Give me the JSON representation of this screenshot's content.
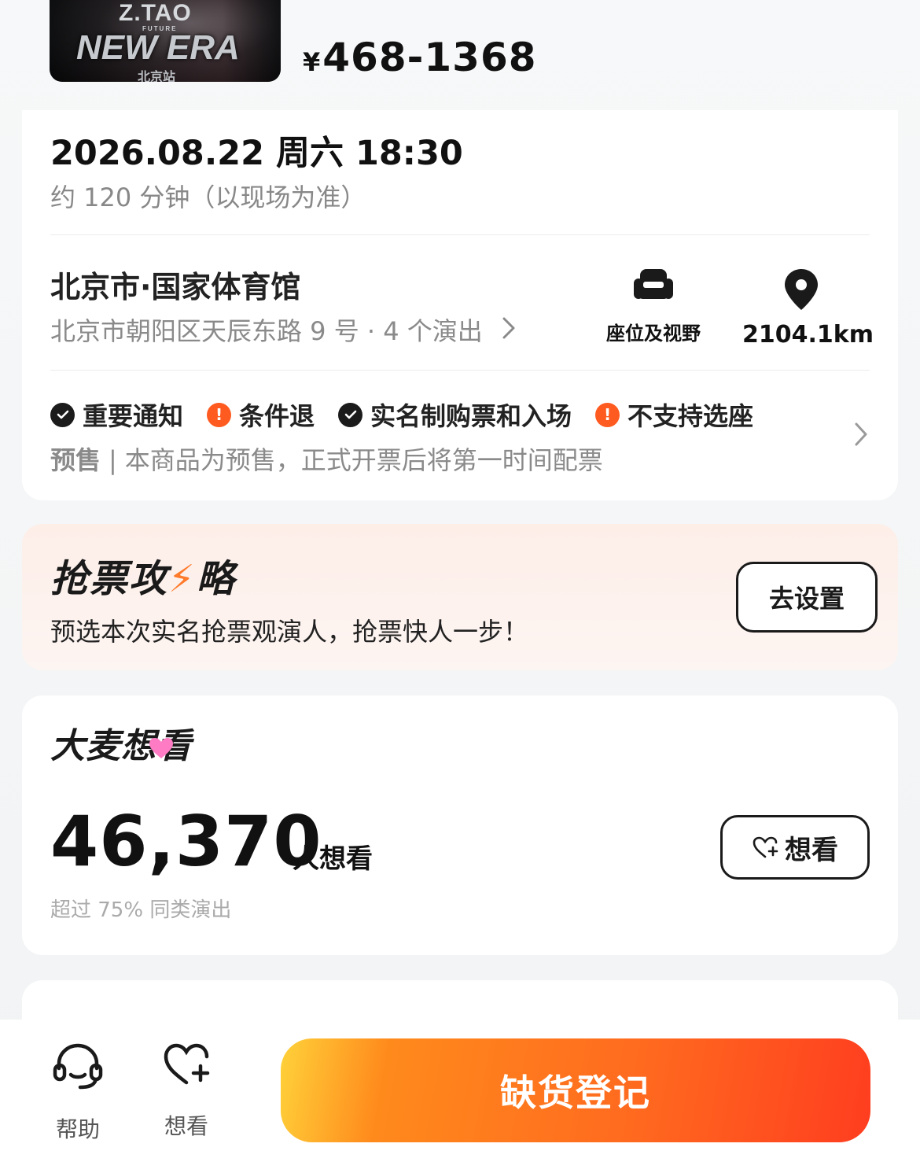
{
  "poster": {
    "line1": "Z.TAO",
    "line2": "FUTURE",
    "line3": "NEW ERA",
    "line4": "北京站"
  },
  "price": {
    "currency": "¥",
    "range": "468-1368"
  },
  "session": {
    "datetime": "2026.08.22 周六 18:30",
    "duration": "约 120 分钟（以现场为准）"
  },
  "venue": {
    "name": "北京市·国家体育馆",
    "address": "北京市朝阳区天辰东路 9 号 · 4 个演出",
    "seat_label": "座位及视野",
    "distance": "2104.1km",
    "seat_icon": "armchair-icon",
    "distance_icon": "location-pin-icon"
  },
  "tags": [
    {
      "label": "重要通知",
      "type": "ok"
    },
    {
      "label": "条件退",
      "type": "warn"
    },
    {
      "label": "实名制购票和入场",
      "type": "ok"
    },
    {
      "label": "不支持选座",
      "type": "warn"
    }
  ],
  "presale": {
    "tag": "预售",
    "text": "本商品为预售，正式开票后将第一时间配票"
  },
  "strategy": {
    "title_a": "抢票",
    "title_b": "攻",
    "title_c": "略",
    "desc": "预选本次实名抢票观演人，抢票快人一步！",
    "button": "去设置"
  },
  "want": {
    "title": "大麦想看",
    "count": "46,370",
    "unit": "人想看",
    "sub": "超过 75% 同类演出",
    "button": "想看"
  },
  "bottom": {
    "help": "帮助",
    "want": "想看",
    "cta": "缺货登记"
  },
  "colors": {
    "accent": "#ff5a1f",
    "cta_start": "#ffd23a",
    "cta_end": "#ff3d1f",
    "strategy_bg": "#fdeee8"
  }
}
